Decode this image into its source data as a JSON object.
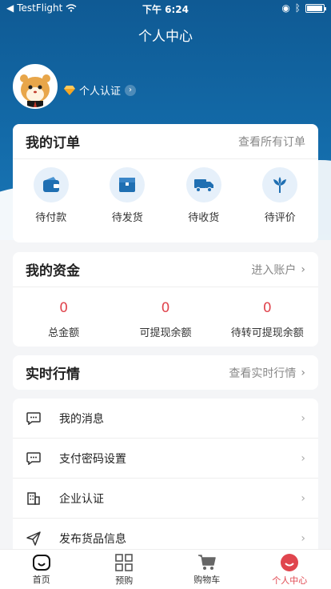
{
  "status_bar": {
    "carrier": "TestFlight",
    "time": "下午 6:24"
  },
  "nav": {
    "title": "个人中心"
  },
  "profile": {
    "verify_label": "个人认证"
  },
  "orders": {
    "title": "我的订单",
    "link": "查看所有订单",
    "items": [
      {
        "label": "待付款",
        "icon": "wallet-icon"
      },
      {
        "label": "待发货",
        "icon": "box-icon"
      },
      {
        "label": "待收货",
        "icon": "truck-icon"
      },
      {
        "label": "待评价",
        "icon": "flower-icon"
      }
    ]
  },
  "funds": {
    "title": "我的资金",
    "link": "进入账户",
    "items": [
      {
        "value": "0",
        "label": "总金额"
      },
      {
        "value": "0",
        "label": "可提现余额"
      },
      {
        "value": "0",
        "label": "待转可提现余额"
      }
    ]
  },
  "market": {
    "title": "实时行情",
    "link": "查看实时行情"
  },
  "menu": [
    {
      "label": "我的消息",
      "icon": "message-icon"
    },
    {
      "label": "支付密码设置",
      "icon": "password-icon"
    },
    {
      "label": "企业认证",
      "icon": "building-icon"
    },
    {
      "label": "发布货品信息",
      "icon": "send-icon"
    }
  ],
  "tabs": [
    {
      "label": "首页",
      "icon": "home-icon"
    },
    {
      "label": "预购",
      "icon": "grid-icon"
    },
    {
      "label": "购物车",
      "icon": "cart-icon"
    },
    {
      "label": "个人中心",
      "icon": "user-icon"
    }
  ],
  "colors": {
    "primary": "#136aa8",
    "accent": "#e0454e",
    "icon_blue": "#1f6fb2"
  }
}
